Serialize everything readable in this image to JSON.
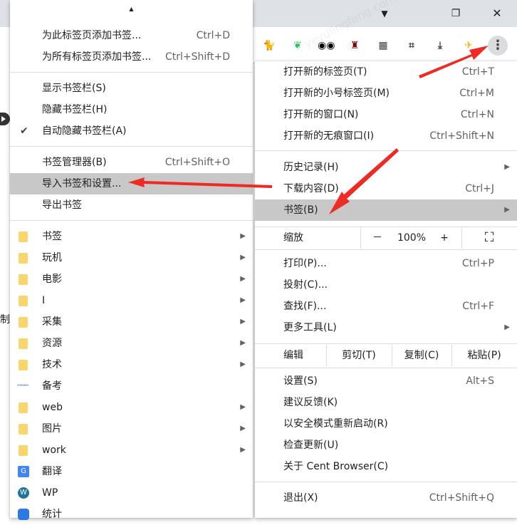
{
  "window": {
    "dropdown_glyph": "▼",
    "restore_glyph": "❐",
    "close_glyph": "✕"
  },
  "extensions": [
    {
      "name": "tampermonkey-cat-icon",
      "glyph": "🐈",
      "color": "#e8b100",
      "badge": ""
    },
    {
      "name": "evernote-icon",
      "glyph": "❦",
      "color": "#2dbe60",
      "badge": ""
    },
    {
      "name": "tampermonkey-icon",
      "glyph": "◉◉",
      "color": "#000000",
      "badge": ""
    },
    {
      "name": "ublock-icon",
      "glyph": "♜",
      "color": "#800000",
      "badge": "2"
    },
    {
      "name": "grid-apps-icon",
      "glyph": "▦",
      "color": "#3c4043",
      "badge": ""
    },
    {
      "name": "crop-icon",
      "glyph": "⌗",
      "color": "#3c4043",
      "badge": ""
    },
    {
      "name": "download-icon",
      "glyph": "⤓",
      "color": "#3c4043",
      "badge": "1"
    },
    {
      "name": "profile-avatar-icon",
      "glyph": "✈",
      "color": "#f4b400",
      "badge": ""
    }
  ],
  "menu_button_glyph": "⋮",
  "page": {
    "partial_text": "制"
  },
  "watermark": "yeyulingfeng.com",
  "bookmarks_menu": {
    "scroll_up_glyph": "▲",
    "add_page": {
      "label": "为此标签页添加书签...",
      "shortcut": "Ctrl+D"
    },
    "add_all": {
      "label": "为所有标签页添加书签...",
      "shortcut": "Ctrl+Shift+D"
    },
    "show_bar": "显示书签栏(S)",
    "hide_bar": "隐藏书签栏(H)",
    "auto_hide": "自动隐藏书签栏(A)",
    "check_glyph": "✔",
    "manager": {
      "label": "书签管理器(B)",
      "shortcut": "Ctrl+Shift+O"
    },
    "import": "导入书签和设置...",
    "export": "导出书签",
    "submenu_arrow": "▶",
    "folders": [
      "书签",
      "玩机",
      "电影",
      "I",
      "采集",
      "资源",
      "技术"
    ],
    "link_beikao": "备考",
    "folders2": [
      "web",
      "图片",
      "work"
    ],
    "translate": "翻译",
    "wp": "WP",
    "stats": "统计"
  },
  "main_menu": {
    "new_tab": {
      "label": "打开新的标签页(T)",
      "shortcut": "Ctrl+T"
    },
    "new_small_tab": {
      "label": "打开新的小号标签页(M)",
      "shortcut": "Ctrl+M"
    },
    "new_window": {
      "label": "打开新的窗口(N)",
      "shortcut": "Ctrl+N"
    },
    "incognito": {
      "label": "打开新的无痕窗口(I)",
      "shortcut": "Ctrl+Shift+N"
    },
    "history": "历史记录(H)",
    "downloads": {
      "label": "下载内容(D)",
      "shortcut": "Ctrl+J"
    },
    "bookmarks": "书签(B)",
    "zoom": {
      "label": "缩放",
      "minus": "－",
      "value": "100%",
      "plus": "+",
      "fullscreen": "⛶"
    },
    "print": {
      "label": "打印(P)...",
      "shortcut": "Ctrl+P"
    },
    "cast": "投射(C)...",
    "find": {
      "label": "查找(F)...",
      "shortcut": "Ctrl+F"
    },
    "more_tools": "更多工具(L)",
    "edit": {
      "label": "编辑",
      "cut": "剪切(T)",
      "copy": "复制(C)",
      "paste": "粘贴(P)"
    },
    "settings": {
      "label": "设置(S)",
      "shortcut": "Alt+S"
    },
    "feedback": "建议反馈(K)",
    "safe_restart": "以安全模式重新启动(R)",
    "check_update": "检查更新(U)",
    "about": "关于 Cent Browser(C)",
    "exit": {
      "label": "退出(X)",
      "shortcut": "Ctrl+Shift+Q"
    },
    "submenu_arrow": "▶"
  },
  "colors": {
    "annotation_red": "#ee2a24",
    "highlight": "#c8c8c8",
    "folder": "#f9d56e"
  }
}
